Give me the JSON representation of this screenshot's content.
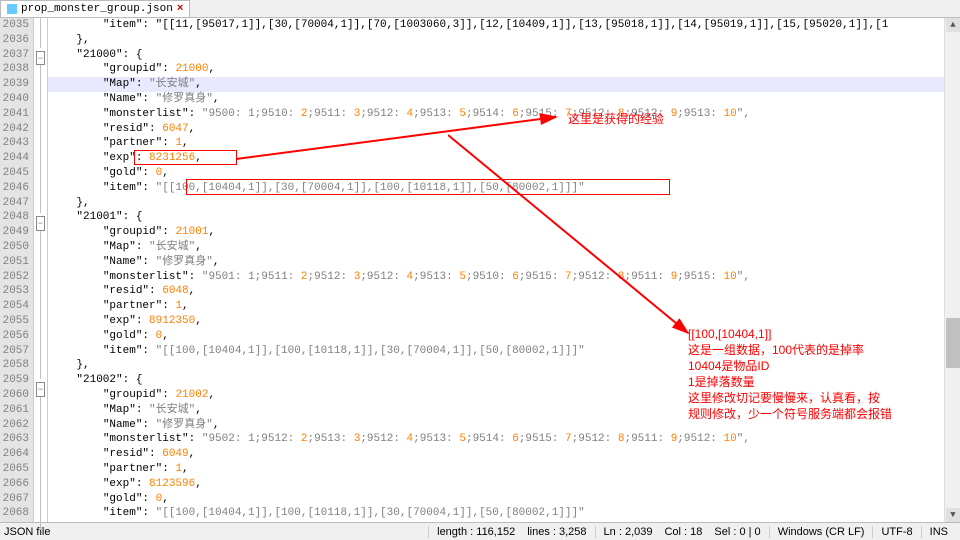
{
  "tab": {
    "filename": "prop_monster_group.json",
    "close": "×"
  },
  "line_start": 2035,
  "line_end": 2068,
  "cursor_line_index": 4,
  "fold": {
    "2037": "minus",
    "2048": "minus",
    "2059": "minus"
  },
  "annotations": {
    "note1": "这里是获得的经验",
    "note2_l1": "[[100,[10404,1]]",
    "note2_l2": "这是一组数据，100代表的是掉率",
    "note2_l3": "10404是物品ID",
    "note2_l4": "1是掉落数量",
    "note2_l5": "这里修改切记要慢慢来，认真看，按",
    "note2_l6": "规则修改，少一个符号服务端都会报错"
  },
  "statusbar": {
    "type": "JSON file",
    "length": "length : 116,152",
    "lines": "lines : 3,258",
    "ln": "Ln : 2,039",
    "col": "Col : 18",
    "sel": "Sel : 0 | 0",
    "eol": "Windows (CR LF)",
    "enc": "UTF-8",
    "ins": "INS"
  },
  "code": [
    "        \"item\": \"[[11,[95017,1]],[30,[70004,1]],[70,[1003060,3]],[12,[10409,1]],[13,[95018,1]],[14,[95019,1]],[15,[95020,1]],[1",
    "    },",
    "    \"21000\": {",
    "        \"groupid\": 21000,",
    "        \"Map\": \"长安城\",",
    "        \"Name\": \"修罗真身\",",
    "        \"monsterlist\": \"9500:1;9510:2;9511:3;9512:4;9513:5;9514:6;9515:7;9512:8;9512:9;9513:10\",",
    "        \"resid\": 6047,",
    "        \"partner\": 1,",
    "        \"exp\": 8231256,",
    "        \"gold\": 0,",
    "        \"item\": \"[[100,[10404,1]],[30,[70004,1]],[100,[10118,1]],[50,[80002,1]]]\"",
    "    },",
    "    \"21001\": {",
    "        \"groupid\": 21001,",
    "        \"Map\": \"长安城\",",
    "        \"Name\": \"修罗真身\",",
    "        \"monsterlist\": \"9501:1;9511:2;9512:3;9512:4;9513:5;9510:6;9515:7;9512:8;9511:9;9515:10\",",
    "        \"resid\": 6048,",
    "        \"partner\": 1,",
    "        \"exp\": 8912350,",
    "        \"gold\": 0,",
    "        \"item\": \"[[100,[10404,1]],[100,[10118,1]],[30,[70004,1]],[50,[80002,1]]]\"",
    "    },",
    "    \"21002\": {",
    "        \"groupid\": 21002,",
    "        \"Map\": \"长安城\",",
    "        \"Name\": \"修罗真身\",",
    "        \"monsterlist\": \"9502:1;9512:2;9513:3;9512:4;9513:5;9514:6;9515:7;9512:8;9511:9;9512:10\",",
    "        \"resid\": 6049,",
    "        \"partner\": 1,",
    "        \"exp\": 8123596,",
    "        \"gold\": 0,",
    "        \"item\": \"[[100,[10404,1]],[100,[10118,1]],[30,[70004,1]],[50,[80002,1]]]\""
  ]
}
